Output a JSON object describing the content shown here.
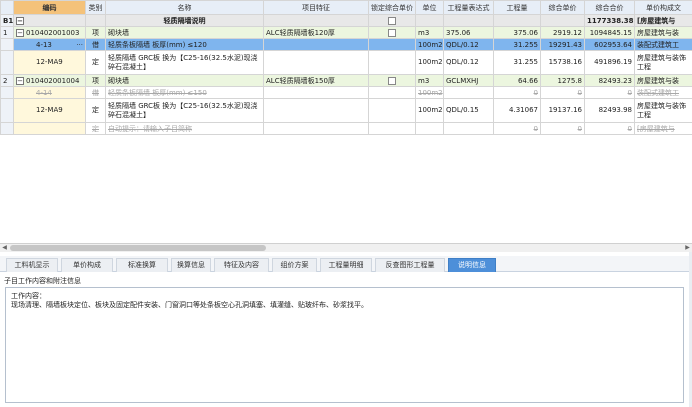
{
  "columns": [
    "",
    "编码",
    "类别",
    "名称",
    "项目特征",
    "锁定综合单价",
    "单位",
    "工程量表达式",
    "工程量",
    "综合单价",
    "综合合价",
    "单价构成文"
  ],
  "rows": [
    {
      "kind": "sect",
      "num": "B1",
      "exp": "−",
      "code": "",
      "type": "",
      "name": "轻质隔墙说明",
      "feature": "",
      "unit": "",
      "expr": "",
      "qty": "",
      "price": "",
      "total": "1177338.38",
      "tpl": "[房屋建筑与"
    },
    {
      "kind": "qd",
      "num": "1",
      "exp": "−",
      "code": "010402001003",
      "type": "项",
      "name": "砌块墙",
      "feature": "ALC轻质隔墙板120厚",
      "unit": "m3",
      "expr": "375.06",
      "qty": "375.06",
      "price": "2919.12",
      "total": "1094845.15",
      "tpl": "房屋建筑与装"
    },
    {
      "kind": "sel",
      "num": "",
      "exp": "",
      "code": "4-13",
      "code_btn": "···",
      "type": "借",
      "name": "轻质条板隔墙 板厚(mm) ≤120",
      "feature": "",
      "unit": "100m2",
      "expr": "QDL/0.12",
      "qty": "31.255",
      "price": "19291.43",
      "total": "602953.64",
      "tpl": "装配式建筑工"
    },
    {
      "kind": "tall",
      "num": "",
      "exp": "",
      "code": "12-MA9",
      "type": "定",
      "name": "轻质隔墙 GRC板   换为【C25-16(32.5水泥)现浇碎石混凝土】",
      "feature": "",
      "unit": "100m2",
      "expr": "QDL/0.12",
      "qty": "31.255",
      "price": "15738.16",
      "total": "491896.19",
      "tpl": "房屋建筑与装饰工程"
    },
    {
      "kind": "qd",
      "num": "2",
      "exp": "−",
      "code": "010402001004",
      "type": "项",
      "name": "砌块墙",
      "feature": "ALC轻质隔墙板150厚",
      "unit": "m3",
      "expr": "GCLMXHJ",
      "qty": "64.66",
      "price": "1275.8",
      "total": "82493.23",
      "tpl": "房屋建筑与装"
    },
    {
      "kind": "strike",
      "num": "",
      "exp": "",
      "code": "4-14",
      "type": "借",
      "name": "轻质条板隔墙 板厚(mm) ≤150",
      "feature": "",
      "unit": "100m2",
      "expr": "",
      "qty": "0",
      "price": "0",
      "total": "0",
      "tpl": "装配式建筑工"
    },
    {
      "kind": "tall",
      "num": "",
      "exp": "",
      "code": "12-MA9",
      "type": "定",
      "name": "轻质隔墙 GRC板   换为【C25-16(32.5水泥)现浇碎石混凝土】",
      "feature": "",
      "unit": "100m2",
      "expr": "QDL/0.15",
      "qty": "4.31067",
      "price": "19137.16",
      "total": "82493.98",
      "tpl": "房屋建筑与装饰工程"
    },
    {
      "kind": "strike",
      "num": "",
      "exp": "",
      "code": "",
      "type": "定",
      "name": "自动提示：请输入子目简称",
      "feature": "",
      "unit": "",
      "expr": "",
      "qty": "0",
      "price": "0",
      "total": "0",
      "tpl": "[房屋建筑与"
    }
  ],
  "tabs": [
    "工料机显示",
    "单价构成",
    "标准换算",
    "换算信息",
    "特征及内容",
    "组价方案",
    "工程量明细",
    "反查图形工程量",
    "说明信息"
  ],
  "active_tab": "说明信息",
  "pane": {
    "title": "子目工作内容和附注信息",
    "content_label": "工作内容：",
    "content_text": "现场清理、隔墙板块定位、板块及固定配件安装、门窗洞口等处条板空心孔洞填塞、填灌缝、贴玻纤布、砂浆找平。"
  },
  "scroll": {
    "left_arrow": "◀",
    "right_arrow": "▶"
  }
}
